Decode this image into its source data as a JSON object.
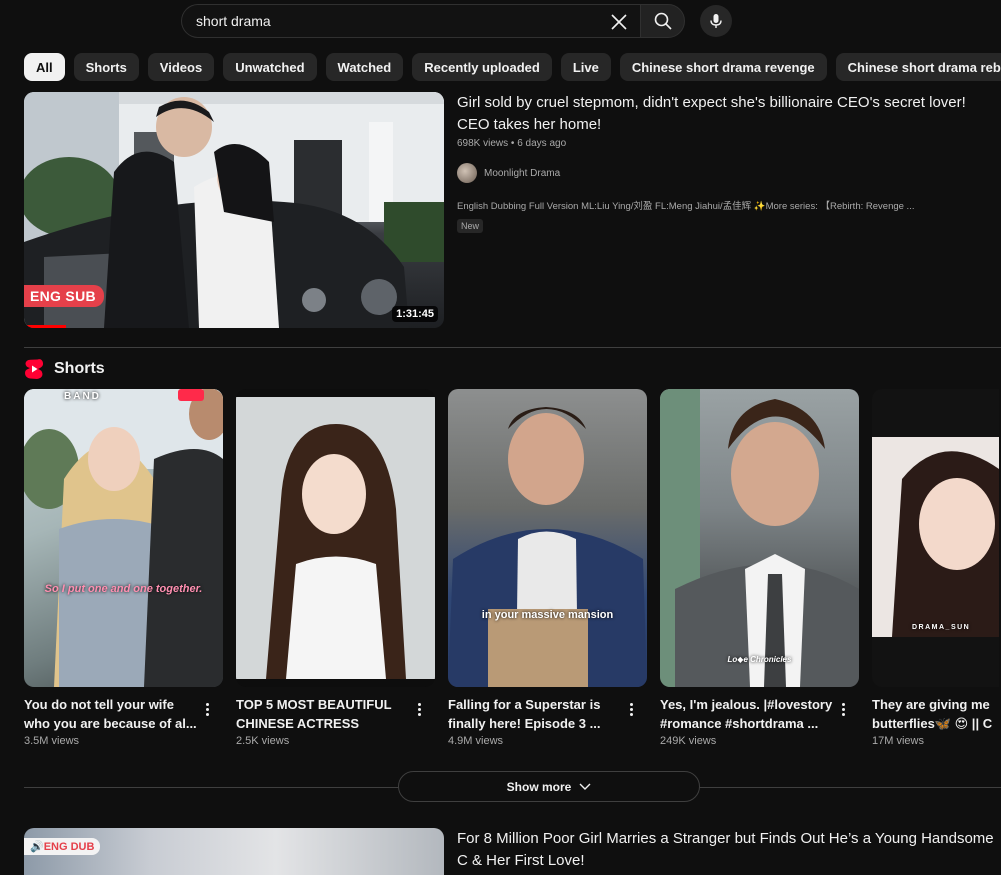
{
  "search": {
    "value": "short drama"
  },
  "chips": [
    "All",
    "Shorts",
    "Videos",
    "Unwatched",
    "Watched",
    "Recently uploaded",
    "Live",
    "Chinese short drama revenge",
    "Chinese short drama rebirth"
  ],
  "video1": {
    "title": "Girl sold by cruel stepmom, didn't expect she's billionaire CEO's secret lover! CEO takes her home!",
    "views": "698K views",
    "age": "6 days ago",
    "channel": "Moonlight Drama",
    "description": "English Dubbing Full Version ML:Liu Ying/刘盈 FL:Meng Jiahui/孟佳辉 ✨More series: 【Rebirth: Revenge ...",
    "badge": "New",
    "thumb_label": "ENG SUB",
    "duration": "1:31:45"
  },
  "shorts": {
    "heading": "Shorts",
    "items": [
      {
        "title": "You do not tell your wife who you are because of al...",
        "views": "3.5M views",
        "caption": "So I put one and one together.",
        "overlay": "BAND"
      },
      {
        "title": "TOP 5 MOST BEAUTIFUL CHINESE ACTRESS (SHOR...",
        "views": "2.5K views"
      },
      {
        "title": "Falling for a Superstar is finally here! Episode 3 ...",
        "views": "4.9M views",
        "caption": "in your massive mansion"
      },
      {
        "title": "Yes, I'm jealous. |#lovestory #romance #shortdrama ...",
        "views": "249K views"
      },
      {
        "title": "They are giving me butterflies🦋 😍 || C d",
        "views": "17M views",
        "overlay": "DRAMA_SUN"
      }
    ],
    "show_more": "Show more"
  },
  "video2": {
    "title": "For 8 Million Poor Girl Marries a Stranger but Finds Out He’s a Young Handsome C & Her First Love!",
    "thumb_label": "🔊ENG DUB"
  },
  "colors": {
    "background": "#0f0f0f",
    "chip": "#272727",
    "accent_red": "#ff0000",
    "label_red": "#e5404a"
  }
}
